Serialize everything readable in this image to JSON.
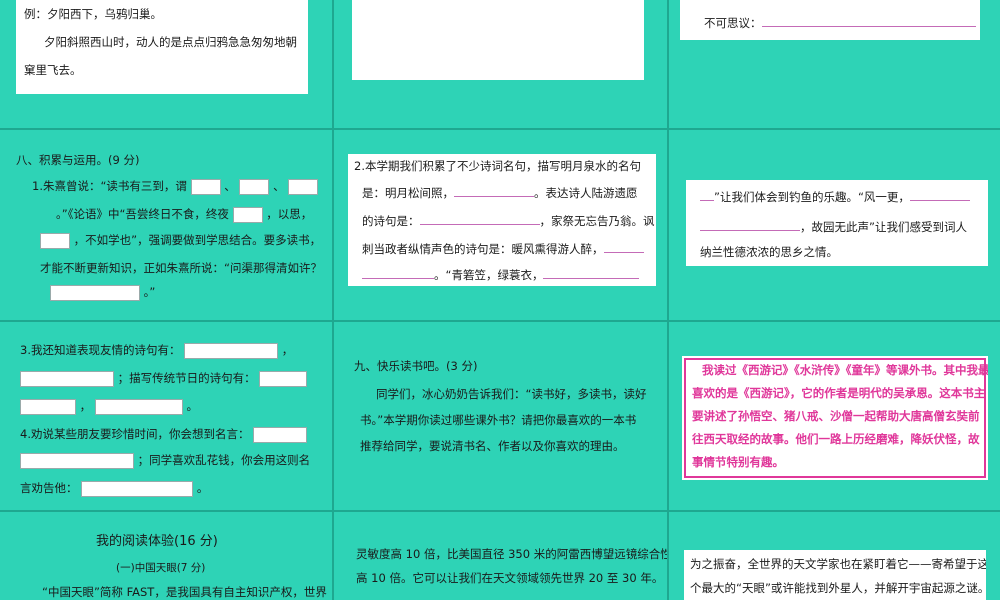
{
  "cell_1": {
    "line1": "例：夕阳西下，乌鸦归巢。",
    "line2": "夕阳斜照西山时，动人的是点点归鸦急急匆匆地朝",
    "line3": "窠里飞去。"
  },
  "cell_3": {
    "line1": "不可思议："
  },
  "cell_4": {
    "heading": "八、积累与运用。(9 分)",
    "l1a": "1.朱熹曾说：“读书有三到，谓",
    "l1sep1": "、",
    "l1sep2": "、",
    "l2a": "。”《论语》中“吾尝终日不食，终夜",
    "l2b": "，以思，",
    "l3b": "，不如学也”，强调要做到学思结合。要多读书，",
    "l4": "才能不断更新知识，正如朱熹所说：“问渠那得清如许？",
    "l5b": "。”"
  },
  "cell_5": {
    "l1": "2.本学期我们积累了不少诗词名句，描写明月泉水的名句",
    "l2a": "是：明月松间照，",
    "l2b": "。表达诗人陆游遗愿",
    "l3a": "的诗句是：",
    "l3b": "，家祭无忘告乃翁。讽",
    "l4a": "刺当政者纵情声色的诗句是：暖风熏得游人醉，",
    "l5b": "。“青箬笠，绿蓑衣，"
  },
  "cell_6": {
    "l1b": "”让我们体会到钓鱼的乐趣。“风一更，",
    "l2b": "，故园无此声”让我们感受到词人",
    "l3": "纳兰性德浓浓的思乡之情。"
  },
  "cell_7": {
    "l1a": "3.我还知道表现友情的诗句有：",
    "l1b": "，",
    "l2b": "；描写传统节日的诗句有：",
    "l3b": "，",
    "l3c": "。",
    "l4a": "4.劝说某些朋友要珍惜时间，你会想到名言：",
    "l5b": "；同学喜欢乱花钱，你会用这则名",
    "l6a": "言劝告他：",
    "l6b": "。"
  },
  "cell_8": {
    "heading": "九、快乐读书吧。(3 分)",
    "l1": "同学们，冰心奶奶告诉我们：“读书好，多读书，读好",
    "l2": "书。”本学期你读过哪些课外书？请把你最喜欢的一本书",
    "l3": "推荐给同学，要说清书名、作者以及你喜欢的理由。"
  },
  "cell_9": {
    "l1": "我读过《西游记》《水浒传》《童年》等课外书。其中我最",
    "l2": "喜欢的是《西游记》，它的作者是明代的吴承恩。这本书主",
    "l3": "要讲述了孙悟空、猪八戒、沙僧一起帮助大唐高僧玄奘前",
    "l4": "往西天取经的故事。他们一路上历经磨难，降妖伏怪，故",
    "l5": "事情节特别有趣。"
  },
  "cell_10": {
    "title": "我的阅读体验(16 分)",
    "subtitle": "(一)中国天眼(7 分)",
    "l1": "“中国天眼”简称 FAST，是我国具有自主知识产权，世界"
  },
  "cell_11": {
    "l1": "灵敏度高 10 倍，比美国直径 350 米的阿雷西博望远镜综合性",
    "l2": "高 10 倍。它可以让我们在天文领域领先世界 20 至 30 年。"
  },
  "cell_12": {
    "l1": "为之振奋，全世界的天文学家也在紧盯着它——寄希望于这",
    "l2": "个最大的“天眼”或许能找到外星人，并解开宇宙起源之谜。"
  },
  "colors": {
    "background": "#2ed3b6",
    "card": "#ffffff",
    "answer": "#e0379a"
  }
}
